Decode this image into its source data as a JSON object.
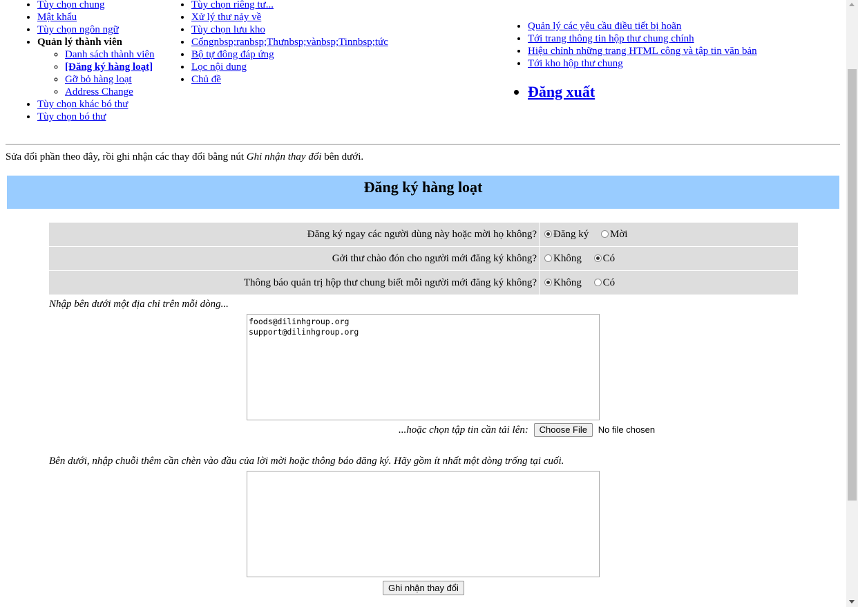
{
  "nav": {
    "col1": [
      {
        "label": "Tùy chọn chung"
      },
      {
        "label": "Mật khẩu"
      },
      {
        "label": "Tùy chọn ngôn ngữ"
      },
      {
        "label": "Quản lý thành viên"
      },
      {
        "label": "Tùy chọn khác bó thư"
      },
      {
        "label": "Tùy chọn bó thư"
      }
    ],
    "members_sub": [
      {
        "label": "Danh sách thành viên"
      },
      {
        "label": "[Đăng ký hàng loạt]"
      },
      {
        "label": "Gỡ bỏ hàng loạt"
      },
      {
        "label": "Address Change"
      }
    ],
    "col2": [
      {
        "label": "Tùy chọn riêng tư..."
      },
      {
        "label": "Xử lý thư nảy về"
      },
      {
        "label": "Tùy chọn lưu kho"
      },
      {
        "label": "Cổngnbsp;ranbsp;Thưnbsp;vànbsp;Tinnbsp;tức"
      },
      {
        "label": "Bộ tự đông đáp ứng"
      },
      {
        "label": "Lọc nội dung"
      },
      {
        "label": "Chủ đề"
      }
    ],
    "col3": [
      {
        "label": "Quản lý các yêu cầu điều tiết bị hoãn"
      },
      {
        "label": "Tới trang thông tin hộp thư chung chính"
      },
      {
        "label": "Hiệu chỉnh những trang HTML công và tập tin văn bản"
      },
      {
        "label": "Tới kho hộp thư chung"
      }
    ],
    "logout": "Đăng xuất"
  },
  "intro": {
    "before": "Sửa đổi phần theo đây, rồi ghi nhận các thay đổi bằng nút ",
    "button_ref": "Ghi nhận thay đổi",
    "after": " bên dưới."
  },
  "banner": {
    "title": "Đăng ký hàng loạt"
  },
  "options": [
    {
      "question": "Đăng ký ngay các người dùng này hoặc mời họ không?",
      "choices": [
        "Đăng ký",
        "Mời"
      ],
      "selected": 0
    },
    {
      "question": "Gởi thư chào đón cho người mới đăng ký không?",
      "choices": [
        "Không",
        "Có"
      ],
      "selected": 1
    },
    {
      "question": "Thông báo quản trị hộp thư chung biết mỗi người mới đăng ký không?",
      "choices": [
        "Không",
        "Có"
      ],
      "selected": 0
    }
  ],
  "addresses": {
    "label": "Nhập bên dưới một địa chỉ trên mỗi dòng...",
    "value": "foods@dilinhgroup.org\nsupport@dilinhgroup.org"
  },
  "upload": {
    "label": "...hoặc chọn tập tin cần tải lên:",
    "button": "Choose File",
    "status": "No file chosen"
  },
  "invite": {
    "label": "Bên dưới, nhập chuỗi thêm cần chèn vào đầu của lời mời hoặc thông báo đăng ký. Hãy gồm ít nhất một dòng trống tại cuối.",
    "value": ""
  },
  "submit": {
    "label": "Ghi nhận thay đổi"
  }
}
